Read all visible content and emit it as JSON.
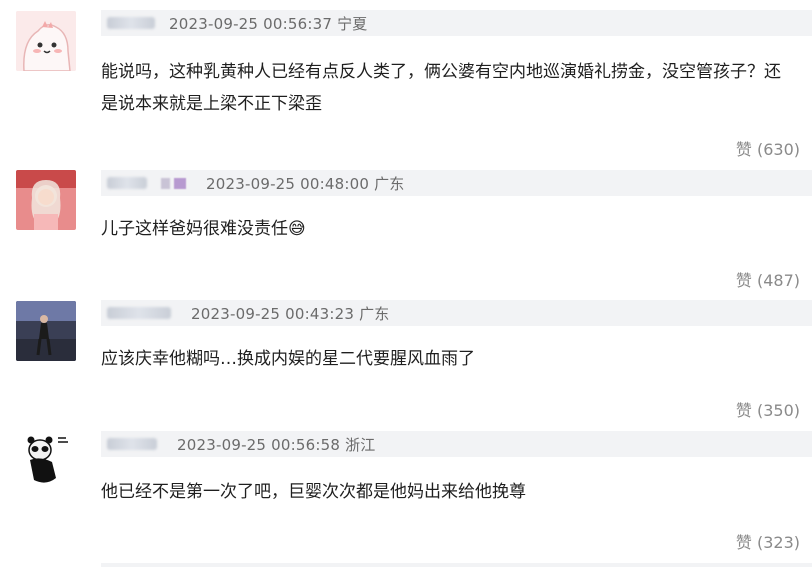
{
  "comments": [
    {
      "meta": "2023-09-25 00:56:37 宁夏",
      "text": "能说吗，这种乳黄种人已经有点反人类了，俩公婆有空内地巡演婚礼捞金，没空管孩子？还是说本来就是上梁不正下梁歪",
      "likes": "赞 (630)",
      "avatar_icon": "cartoon-dinosaur-avatar"
    },
    {
      "meta": "2023-09-25 00:48:00 广东",
      "text": "儿子这样爸妈很难没责任😅",
      "likes": "赞 (487)",
      "avatar_icon": "girl-photo-avatar"
    },
    {
      "meta": "2023-09-25 00:43:23 广东",
      "text": "应该庆幸他糊吗…换成内娱的星二代要腥风血雨了",
      "likes": "赞 (350)",
      "avatar_icon": "dancer-photo-avatar"
    },
    {
      "meta": "2023-09-25 00:56:58 浙江",
      "text": "他已经不是第一次了吧，巨婴次次都是他妈出来给他挽尊",
      "likes": "赞 (323)",
      "avatar_icon": "panda-meme-avatar"
    }
  ]
}
